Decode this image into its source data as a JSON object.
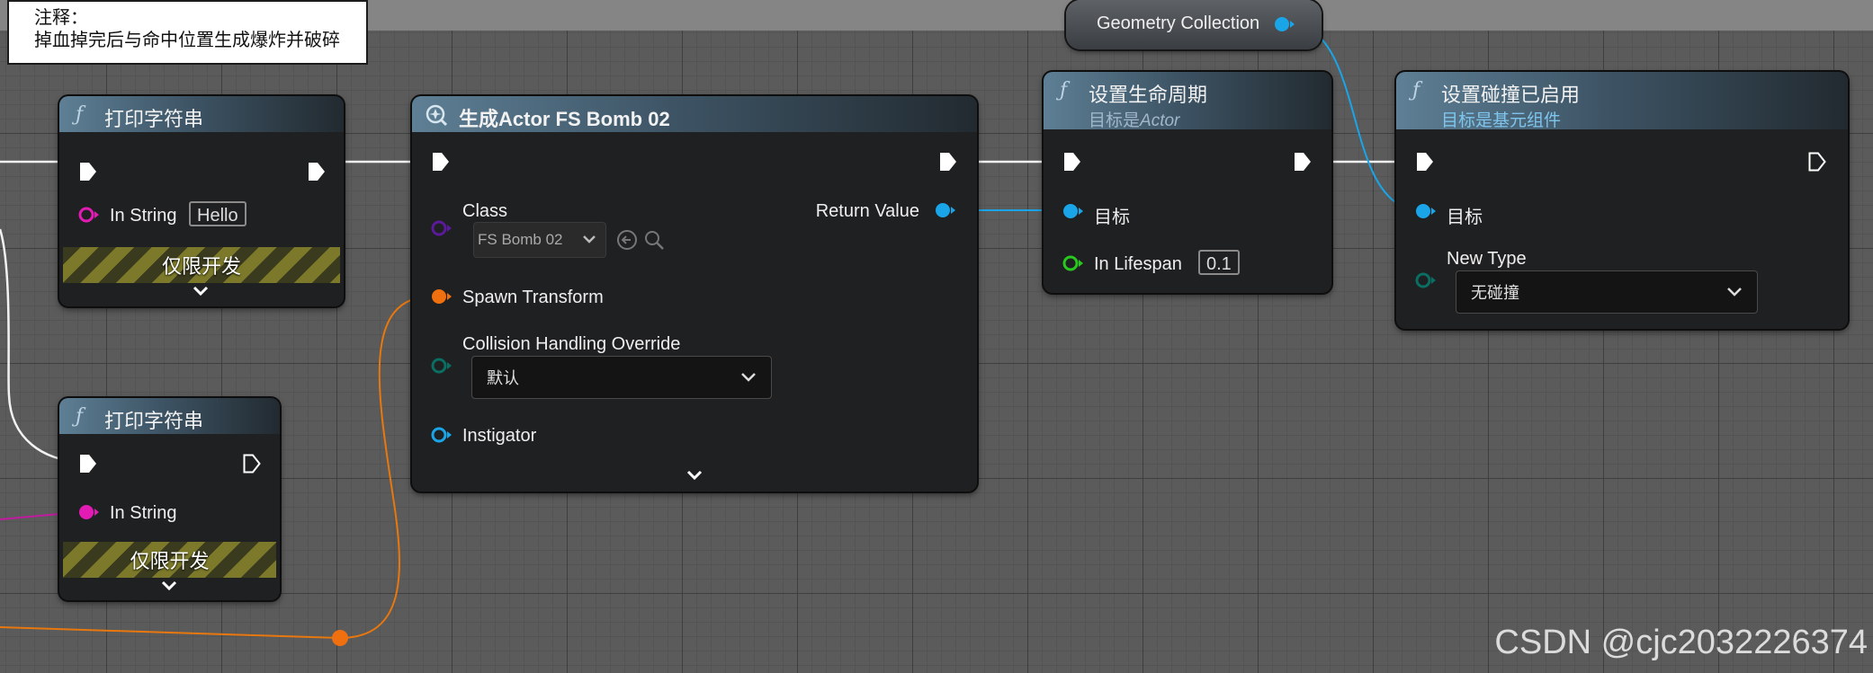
{
  "comment": {
    "line1": "注释：",
    "line2": "掉血掉完后与命中位置生成爆炸并破碎"
  },
  "nodes": {
    "print_top": {
      "title": "打印字符串",
      "in_string_label": "In String",
      "in_string_value": "Hello",
      "dev_only": "仅限开发"
    },
    "print_bottom": {
      "title": "打印字符串",
      "in_string_label": "In String",
      "dev_only": "仅限开发"
    },
    "spawn": {
      "title": "生成Actor FS Bomb 02",
      "class_label": "Class",
      "class_value": "FS Bomb 02",
      "return_label": "Return Value",
      "spawn_transform_label": "Spawn Transform",
      "collision_label": "Collision Handling Override",
      "collision_value": "默认",
      "instigator_label": "Instigator"
    },
    "lifespan": {
      "title": "设置生命周期",
      "subtitle_prefix": "目标是",
      "subtitle_target": "Actor",
      "target_label": "目标",
      "lifespan_label": "In Lifespan",
      "lifespan_value": "0.1"
    },
    "collision": {
      "title": "设置碰撞已启用",
      "subtitle": "目标是基元组件",
      "target_label": "目标",
      "new_type_label": "New Type",
      "new_type_value": "无碰撞"
    },
    "geometry": {
      "label": "Geometry Collection"
    }
  },
  "icons": {
    "function": "ƒ",
    "chevron": "chevron-down-icon"
  },
  "colors": {
    "exec": "#ffffff",
    "string_pin": "#e21bb5",
    "object_pin": "#1aa5e8",
    "class_pin": "#5a1a9a",
    "struct_pin": "#f07010",
    "float_pin": "#28c81e",
    "enum_pin": "#0a6e62",
    "hazard_yellow": "#7c7a2a"
  },
  "watermark": "CSDN @cjc2032226374"
}
